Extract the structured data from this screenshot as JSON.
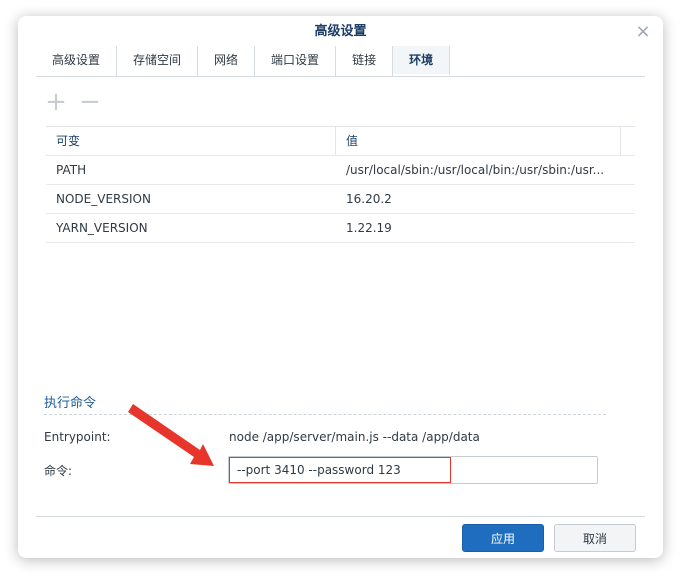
{
  "dialog": {
    "title": "高级设置",
    "close_glyph": "×"
  },
  "tabs": [
    {
      "label": "高级设置"
    },
    {
      "label": "存储空间"
    },
    {
      "label": "网络"
    },
    {
      "label": "端口设置"
    },
    {
      "label": "链接"
    },
    {
      "label": "环境",
      "active": true
    }
  ],
  "toolbar": {
    "add_glyph": "+",
    "remove_glyph": "−"
  },
  "env_table": {
    "headers": {
      "variable": "可变",
      "value": "值"
    },
    "rows": [
      {
        "variable": "PATH",
        "value": "/usr/local/sbin:/usr/local/bin:/usr/sbin:/usr..."
      },
      {
        "variable": "NODE_VERSION",
        "value": "16.20.2"
      },
      {
        "variable": "YARN_VERSION",
        "value": "1.22.19"
      }
    ]
  },
  "exec": {
    "section_title": "执行命令",
    "entrypoint_label": "Entrypoint:",
    "entrypoint_value": "node /app/server/main.js --data /app/data",
    "command_label": "命令:",
    "command_value": "--port 3410 --password 123"
  },
  "buttons": {
    "apply": "应用",
    "cancel": "取消"
  },
  "annotation": {
    "color": "#e8352b"
  }
}
